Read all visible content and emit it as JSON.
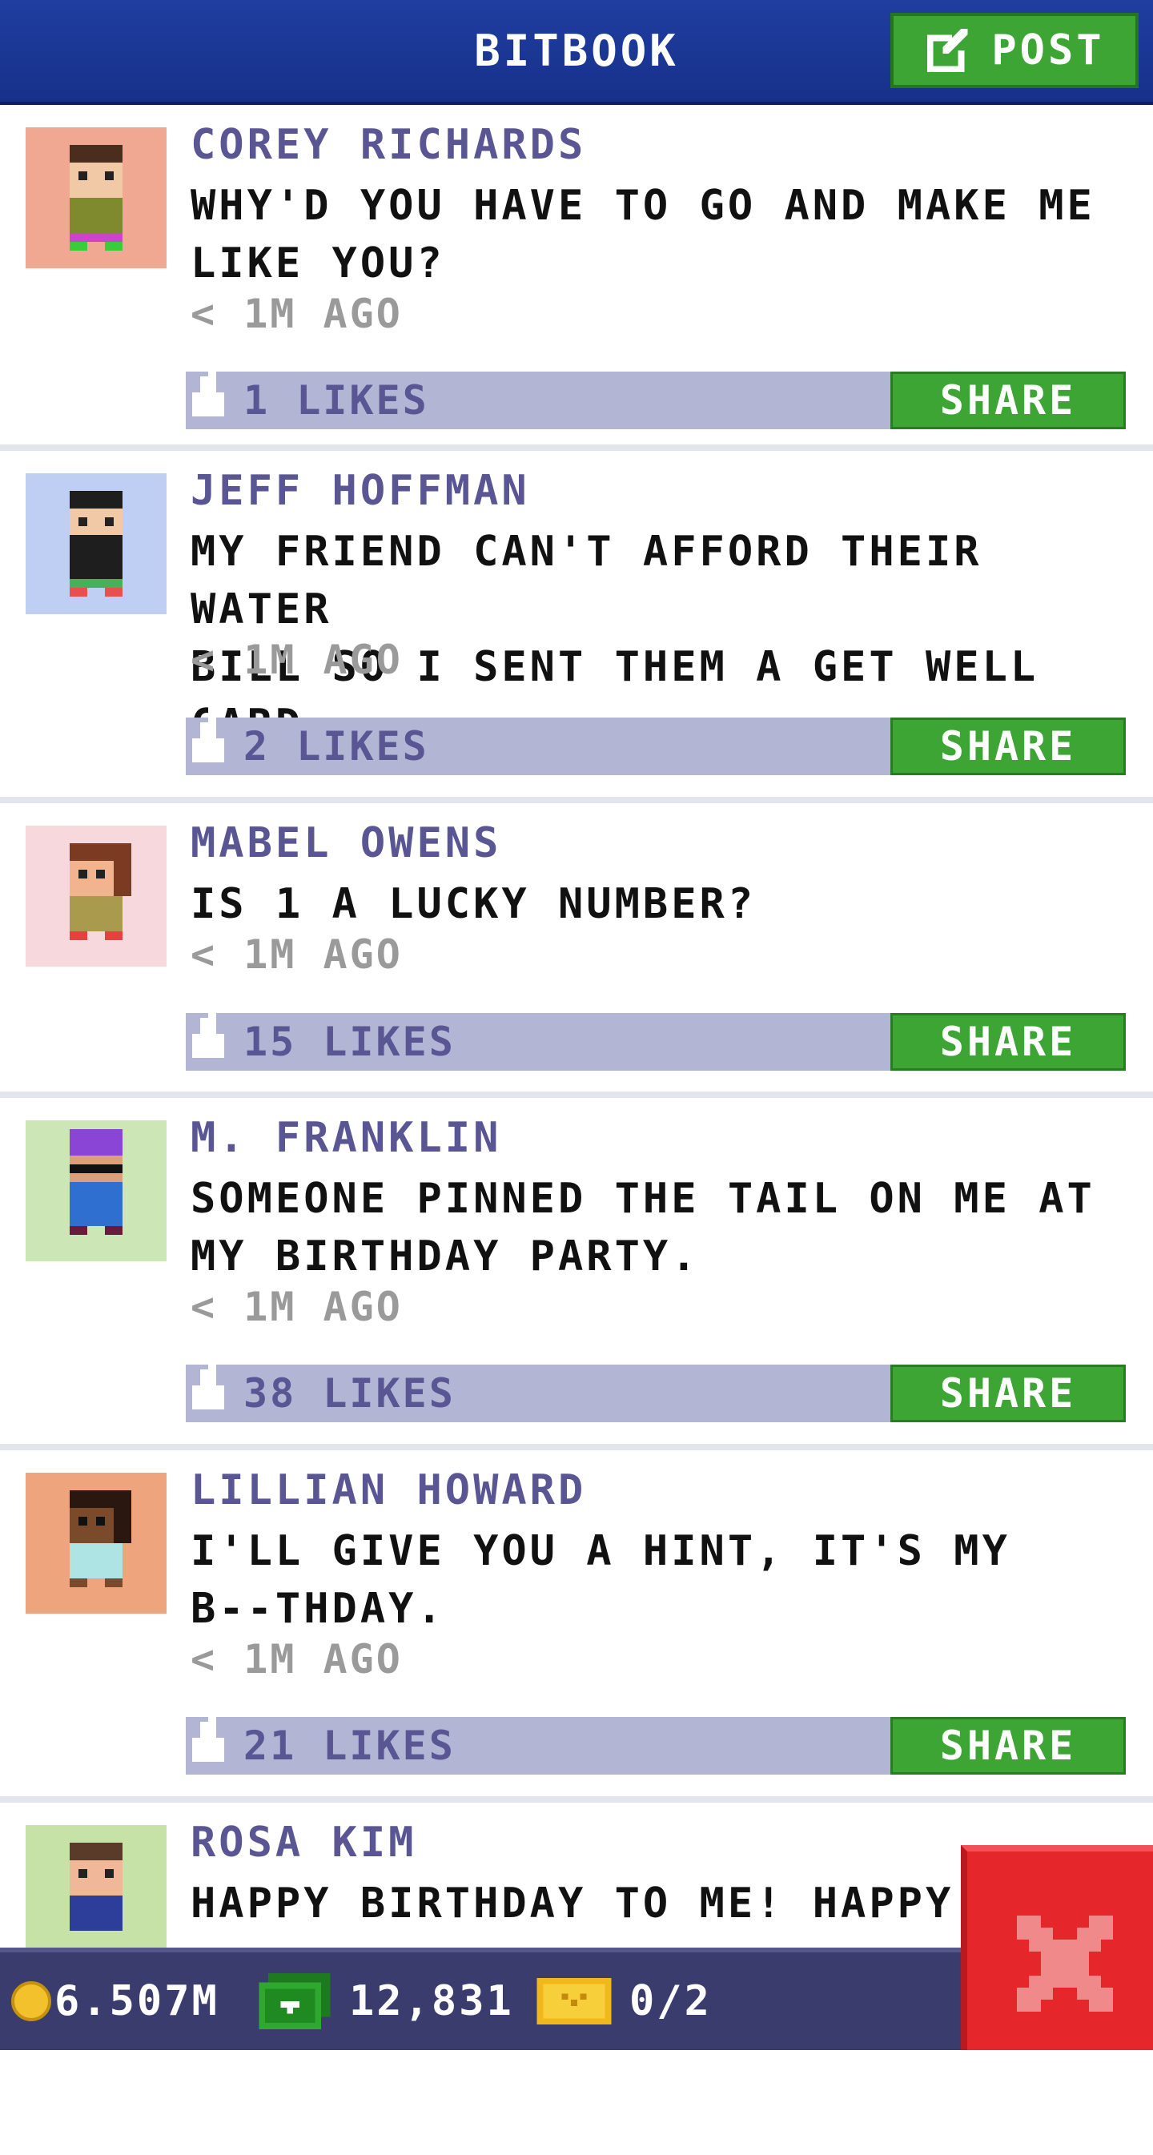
{
  "header": {
    "title": "BITBOOK",
    "post_label": "POST"
  },
  "posts": [
    {
      "author": "COREY RICHARDS",
      "message": "WHY'D YOU HAVE TO GO AND MAKE ME\nLIKE YOU?",
      "time": "< 1M AGO",
      "likes": "1 LIKES",
      "share": "SHARE"
    },
    {
      "author": "JEFF HOFFMAN",
      "message": "MY FRIEND CAN'T AFFORD THEIR WATER\nBILL SO I SENT THEM A GET WELL CARD.",
      "time": "< 1M AGO",
      "likes": "2 LIKES",
      "share": "SHARE"
    },
    {
      "author": "MABEL OWENS",
      "message": "IS 1 A LUCKY NUMBER?",
      "time": "< 1M AGO",
      "likes": "15 LIKES",
      "share": "SHARE"
    },
    {
      "author": "M. FRANKLIN",
      "message": "SOMEONE PINNED THE TAIL ON ME AT\nMY BIRTHDAY PARTY.",
      "time": "< 1M AGO",
      "likes": "38 LIKES",
      "share": "SHARE"
    },
    {
      "author": "LILLIAN HOWARD",
      "message": "I'LL GIVE YOU A HINT, IT'S MY\nB--THDAY.",
      "time": "< 1M AGO",
      "likes": "21 LIKES",
      "share": "SHARE"
    },
    {
      "author": "ROSA KIM",
      "message": "HAPPY BIRTHDAY TO ME! HAPPY"
    }
  ],
  "status": {
    "coins": "6.507M",
    "bux": "12,831",
    "tickets": "0/2"
  },
  "colors": {
    "header": "#17318a",
    "accent_green": "#3ca534",
    "likes_bar": "#b3b5d5",
    "close_red": "#e5262b"
  },
  "icons": {
    "post": "edit-icon",
    "like": "thumb-up-icon",
    "coin": "coin-icon",
    "bux": "cash-icon",
    "ticket": "ticket-icon",
    "close": "close-icon"
  }
}
